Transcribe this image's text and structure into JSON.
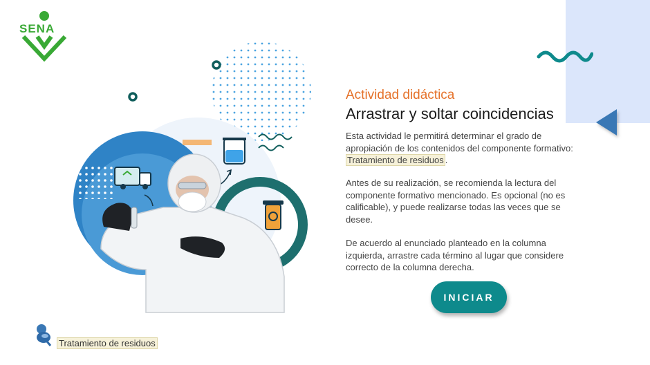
{
  "logo": {
    "text": "SENA"
  },
  "header": {
    "kicker": "Actividad didáctica",
    "title": "Arrastrar y soltar coincidencias"
  },
  "intro": {
    "p1_text": "Esta actividad le permitirá determinar el grado de apropiación de los contenidos del componente formativo:",
    "p1_highlight": "Tratamiento de residuos",
    "p1_end": ".",
    "p2": "Antes de su realización, se recomienda la lectura del componente formativo mencionado. Es opcional (no es calificable), y puede realizarse todas las veces que se desee.",
    "p3": "De acuerdo al enunciado planteado en la columna izquierda, arrastre cada término al lugar que considere correcto de la columna derecha."
  },
  "start_button": {
    "label": "INICIAR"
  },
  "footer": {
    "tag": "Tratamiento de residuos"
  },
  "colors": {
    "accent_orange": "#e5722a",
    "teal": "#0e8a8c",
    "blue": "#3a78b5",
    "panel": "#dbe6fb",
    "logo_green": "#39a935"
  },
  "icons": [
    "sena-logo",
    "back-arrow-icon",
    "wave-icon",
    "truck-icon",
    "beaker-icon",
    "biohazard-bin-icon",
    "pin-icon"
  ]
}
